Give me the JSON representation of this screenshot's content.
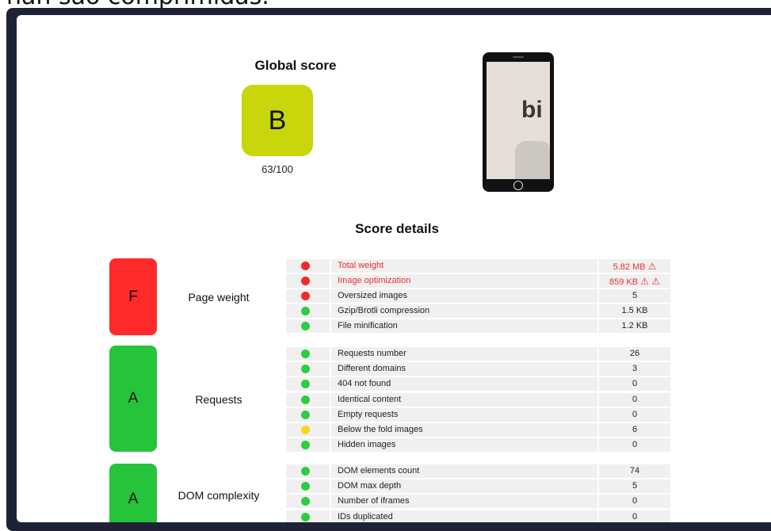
{
  "caption": "nan sao comprimidas.",
  "global": {
    "title": "Global score",
    "grade": "B",
    "grade_color": "#c8d60b",
    "score": "63/100"
  },
  "preview": {
    "screen_text": "bi"
  },
  "details_title": "Score details",
  "colors": {
    "red": "#ee2b2b",
    "green": "#2ecc40",
    "yellow": "#f7d520",
    "grade_f": "#ff2a2a",
    "grade_a": "#25c43b"
  },
  "categories": [
    {
      "grade": "F",
      "label": "Page weight"
    },
    {
      "grade": "A",
      "label": "Requests"
    },
    {
      "grade": "A",
      "label": "DOM complexity"
    }
  ],
  "page_weight_rows": [
    {
      "status": "red",
      "name": "Total weight",
      "value": "5.82 MB",
      "warn": "⚠",
      "bad": true
    },
    {
      "status": "red",
      "name": "Image optimization",
      "value": "859 KB",
      "warn": "⚠ ⚠",
      "bad": true
    },
    {
      "status": "red",
      "name": "Oversized images",
      "value": "5"
    },
    {
      "status": "green",
      "name": "Gzip/Brotli compression",
      "value": "1.5 KB"
    },
    {
      "status": "green",
      "name": "File minification",
      "value": "1.2 KB"
    }
  ],
  "requests_rows": [
    {
      "status": "green",
      "name": "Requests number",
      "value": "26"
    },
    {
      "status": "green",
      "name": "Different domains",
      "value": "3"
    },
    {
      "status": "green",
      "name": "404 not found",
      "value": "0"
    },
    {
      "status": "green",
      "name": "Identical content",
      "value": "0"
    },
    {
      "status": "green",
      "name": "Empty requests",
      "value": "0"
    },
    {
      "status": "yellow",
      "name": "Below the fold images",
      "value": "6"
    },
    {
      "status": "green",
      "name": "Hidden images",
      "value": "0"
    }
  ],
  "dom_rows": [
    {
      "status": "green",
      "name": "DOM elements count",
      "value": "74"
    },
    {
      "status": "green",
      "name": "DOM max depth",
      "value": "5"
    },
    {
      "status": "green",
      "name": "Number of iframes",
      "value": "0"
    },
    {
      "status": "green",
      "name": "IDs duplicated",
      "value": "0"
    }
  ]
}
